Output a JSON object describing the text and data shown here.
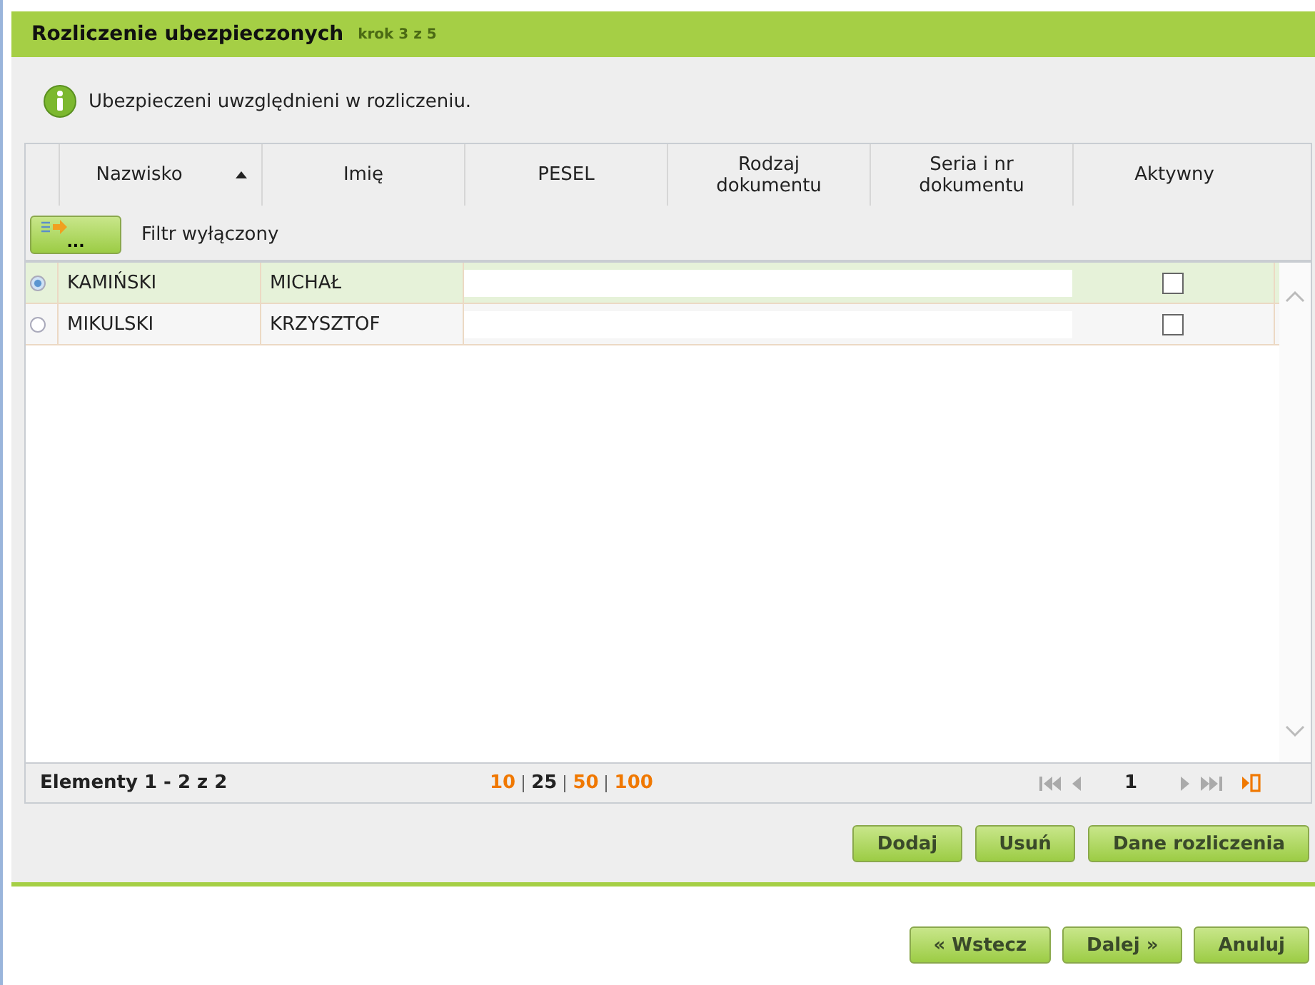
{
  "panel": {
    "title": "Rozliczenie ubezpieczonych",
    "step": "krok 3 z 5"
  },
  "info": "Ubezpieczeni uwzględnieni w rozliczeniu.",
  "table": {
    "columns": [
      {
        "label": "Nazwisko",
        "sorted": true
      },
      {
        "label": "Imię",
        "sorted": false
      },
      {
        "label": "PESEL",
        "sorted": false
      },
      {
        "label": "Rodzaj dokumentu",
        "sorted": false
      },
      {
        "label": "Seria i nr dokumentu",
        "sorted": false
      },
      {
        "label": "Aktywny",
        "sorted": false
      }
    ],
    "filter": {
      "button": "...",
      "status": "Filtr wyłączony"
    },
    "rows": [
      {
        "selected": true,
        "surname": "KAMIŃSKI",
        "name": "MICHAŁ",
        "active": false
      },
      {
        "selected": false,
        "surname": "MIKULSKI",
        "name": "KRZYSZTOF",
        "active": false
      }
    ],
    "footer": {
      "summary": "Elementy 1 - 2 z 2",
      "page_sizes": [
        {
          "label": "10",
          "selected": false
        },
        {
          "label": "25",
          "selected": true
        },
        {
          "label": "50",
          "selected": false
        },
        {
          "label": "100",
          "selected": false
        }
      ],
      "page": "1"
    }
  },
  "actions": [
    "Dodaj",
    "Usuń",
    "Dane rozliczenia"
  ],
  "nav": [
    "« Wstecz",
    "Dalej »",
    "Anuluj"
  ]
}
